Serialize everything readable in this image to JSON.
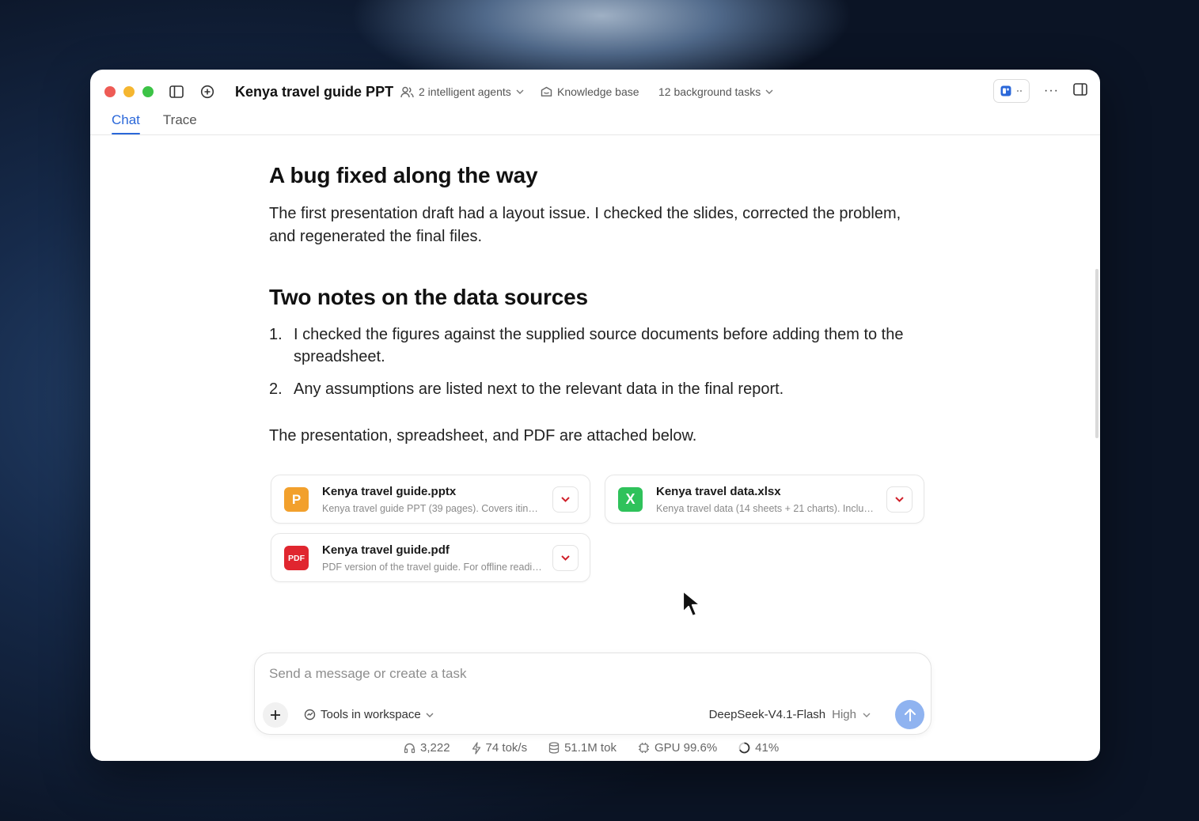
{
  "window": {
    "title": "Kenya travel guide PPT",
    "agents_label": "2 intelligent agents",
    "knowledge_label": "Knowledge base",
    "tasks_label": "12 background tasks",
    "more_label": "···"
  },
  "tabs": [
    {
      "label": "Chat",
      "active": true
    },
    {
      "label": "Trace",
      "active": false
    }
  ],
  "content": {
    "section1_title": "A bug fixed along the way",
    "section1_body": "The first presentation draft had a layout issue. I checked the slides, corrected the problem, and regenerated the final files.",
    "section2_title": "Two notes on the data sources",
    "notes": [
      {
        "num": "1.",
        "text": "I checked the figures against the supplied source documents before adding them to the spreadsheet."
      },
      {
        "num": "2.",
        "text": "Any assumptions are listed next to the relevant data in the final report."
      }
    ],
    "attached_note": "The presentation, spreadsheet, and PDF are attached below."
  },
  "attachments": [
    {
      "icon": "P",
      "icon_color": "#f2a02c",
      "name": "Kenya travel guide.pptx",
      "desc": "Kenya travel guide PPT (39 pages). Covers itinera..."
    },
    {
      "icon": "X",
      "icon_color": "#2fc25b",
      "name": "Kenya travel data.xlsx",
      "desc": "Kenya travel data (14 sheets + 21 charts). Includes ..."
    },
    {
      "icon": "PDF",
      "icon_color": "#e0262f",
      "name": "Kenya travel guide.pdf",
      "desc": "PDF version of the travel guide. For offline reading."
    }
  ],
  "composer": {
    "placeholder": "Send a message or create a task",
    "tools_label": "Tools in workspace",
    "model": "DeepSeek-V4.1-Flash",
    "effort": "High"
  },
  "status": {
    "count": "3,222",
    "speed": "74 tok/s",
    "tokens": "51.1M tok",
    "gpu": "GPU 99.6%",
    "progress": "41%"
  },
  "colors": {
    "accent": "#2a67d9",
    "send_button": "#8fb3f0",
    "chevron_red": "#d0202a"
  }
}
